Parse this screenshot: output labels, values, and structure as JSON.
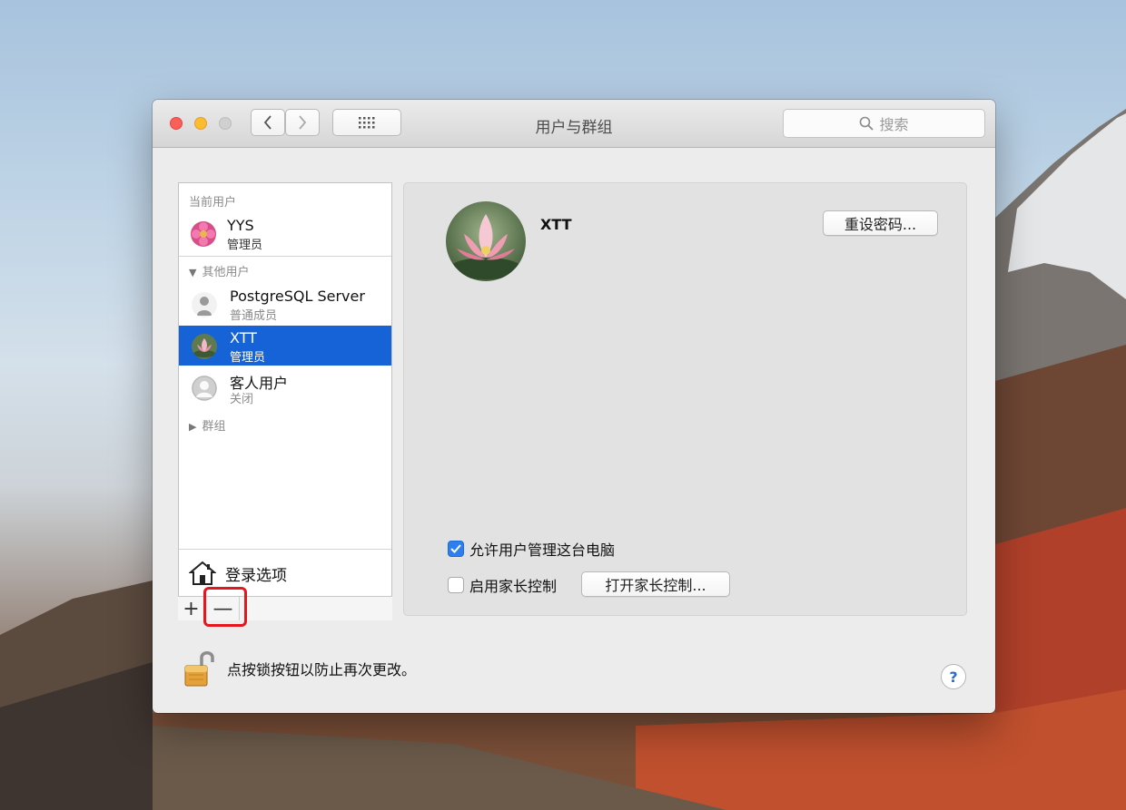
{
  "window": {
    "title": "用户与群组",
    "search_placeholder": "搜索"
  },
  "sidebar": {
    "current_users_label": "当前用户",
    "current_user": {
      "name": "YYS",
      "role": "管理员"
    },
    "other_users_label": "其他用户",
    "other_users": [
      {
        "name": "PostgreSQL Server",
        "role": "普通成员",
        "selected": false
      },
      {
        "name": "XTT",
        "role": "管理员",
        "selected": true
      },
      {
        "name": "客人用户",
        "role": "关闭",
        "selected": false
      }
    ],
    "groups_label": "群组",
    "login_options_label": "登录选项",
    "add_symbol": "+",
    "remove_symbol": "—"
  },
  "detail": {
    "user_name": "XTT",
    "reset_password_label": "重设密码...",
    "allow_admin_label": "允许用户管理这台电脑",
    "allow_admin_checked": true,
    "parental_controls_label": "启用家长控制",
    "parental_controls_checked": false,
    "open_parental_controls_label": "打开家长控制..."
  },
  "footer": {
    "lock_text": "点按锁按钮以防止再次更改。",
    "help_symbol": "?"
  },
  "colors": {
    "selection": "#1563d6",
    "checkbox_on": "#2d7ff0",
    "highlight_box": "#e4171e"
  },
  "icons": [
    "chevron-left-icon",
    "chevron-right-icon",
    "grid-icon",
    "search-icon",
    "house-icon",
    "lock-open-icon",
    "disclosure-triangle-icon",
    "user-silhouette-icon"
  ]
}
